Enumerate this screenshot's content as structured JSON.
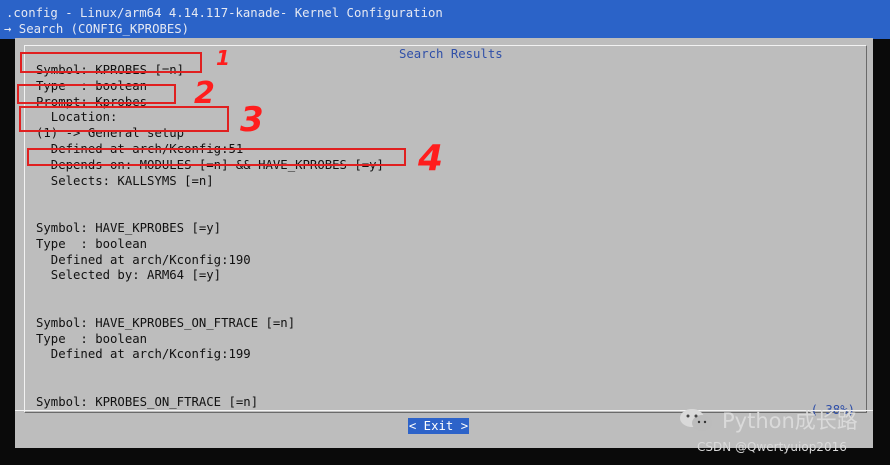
{
  "window": {
    "title": ".config - Linux/arm64 4.14.117-kanade- Kernel Configuration",
    "breadcrumb": "→ Search (CONFIG_KPROBES)"
  },
  "dialog": {
    "title": "Search Results",
    "scroll_percent": "( 38%)",
    "exit_label": "< Exit >"
  },
  "lines": [
    "Symbol: KPROBES [=n]",
    "Type  : boolean",
    "Prompt: Kprobes",
    "  Location:",
    "(1) -> General setup",
    "  Defined at arch/Kconfig:51",
    "  Depends on: MODULES [=n] && HAVE_KPROBES [=y]",
    "  Selects: KALLSYMS [=n]",
    "",
    "",
    "Symbol: HAVE_KPROBES [=y]",
    "Type  : boolean",
    "  Defined at arch/Kconfig:190",
    "  Selected by: ARM64 [=y]",
    "",
    "",
    "Symbol: HAVE_KPROBES_ON_FTRACE [=n]",
    "Type  : boolean",
    "  Defined at arch/Kconfig:199",
    "",
    "",
    "Symbol: KPROBES_ON_FTRACE [=n]"
  ],
  "annotations": [
    "1",
    "2",
    "3",
    "4"
  ],
  "watermark": {
    "text": "Python成长路",
    "credit": "CSDN @Qwertyuiop2016"
  },
  "colors": {
    "title_bar": "#2b63c8",
    "dialog_bg": "#bdbdbd",
    "accent_text": "#2f4fa8",
    "annotation": "#e02020"
  }
}
